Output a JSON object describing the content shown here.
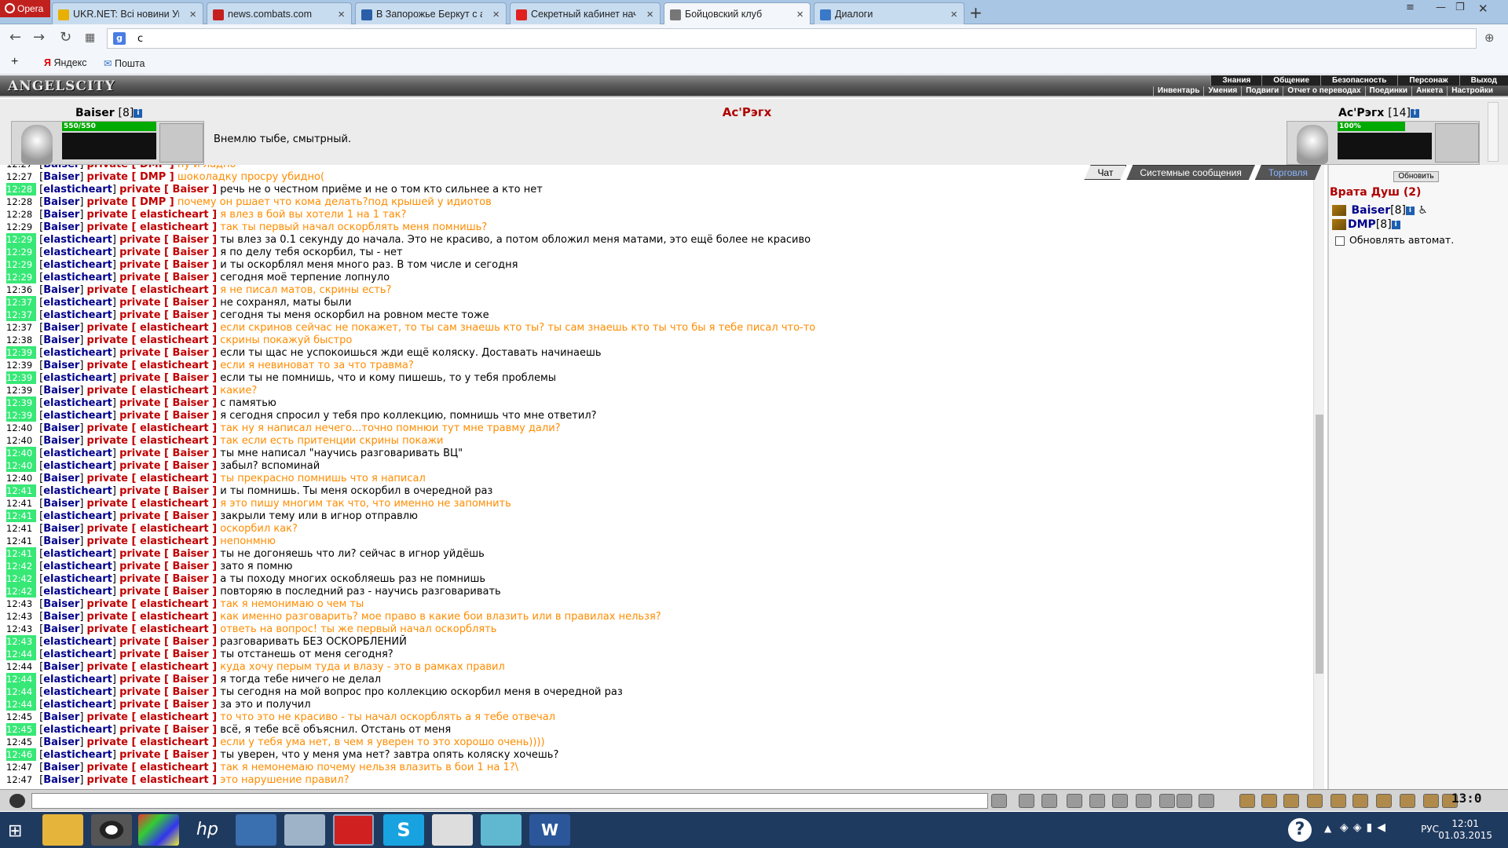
{
  "browser": {
    "menu_label": "Opera",
    "tabs": [
      {
        "label": "UKR.NET: Всі новини Укр",
        "color": "#e8b000"
      },
      {
        "label": "news.combats.com",
        "color": "#c42020"
      },
      {
        "label": "В Запорожье Беркут с ав",
        "color": "#2a5fa8"
      },
      {
        "label": "Секретный кабинет нача",
        "color": "#e02020"
      },
      {
        "label": "Бойцовский клуб",
        "color": "#777777"
      },
      {
        "label": "Диалоги",
        "color": "#3a78c8"
      }
    ],
    "address": "c",
    "bookmarks": [
      "Яндекс",
      "Пошта"
    ]
  },
  "game": {
    "logo": "ANGELSCITY",
    "menu_top": [
      "Знания",
      "Общение",
      "Безопасность",
      "Персонаж",
      "Выход"
    ],
    "menu_sub": [
      "Инвентарь",
      "Умения",
      "Подвиги",
      "Отчет о переводах",
      "Поединки",
      "Анкета",
      "Настройки"
    ]
  },
  "fight": {
    "player": {
      "name": "Baiser",
      "level": "[8]",
      "hp": "550/550"
    },
    "enemy_title": "Ас'Рэгх",
    "enemy": {
      "name": "Ас'Рэгх",
      "level": "[14]",
      "hp": "100%"
    },
    "message": "Внемлю тыбе, смытрный."
  },
  "chat": {
    "tabs": [
      "Чат",
      "Системные сообщения",
      "Торговля"
    ],
    "lines": [
      {
        "time": "12:27",
        "green": false,
        "from": "Baiser",
        "to": "DMP",
        "text": "ну и ладно",
        "out": true
      },
      {
        "time": "12:27",
        "green": false,
        "from": "Baiser",
        "to": "DMP",
        "text": "шоколадку просру убидно(",
        "out": true
      },
      {
        "time": "12:28",
        "green": true,
        "from": "elasticheart",
        "to": "Baiser",
        "text": "речь не о честном приёме и не о том кто сильнее а кто нет",
        "out": false
      },
      {
        "time": "12:28",
        "green": false,
        "from": "Baiser",
        "to": "DMP",
        "text": "почему он ршает что кома делать?под крышей у идиотов",
        "out": true
      },
      {
        "time": "12:28",
        "green": false,
        "from": "Baiser",
        "to": "elasticheart",
        "text": "я влез в бой вы хотели 1 на 1 так?",
        "out": true
      },
      {
        "time": "12:29",
        "green": false,
        "from": "Baiser",
        "to": "elasticheart",
        "text": "так ты первый начал оскорблять меня помнишь?",
        "out": true
      },
      {
        "time": "12:29",
        "green": true,
        "from": "elasticheart",
        "to": "Baiser",
        "text": "ты влез за 0.1 секунду до начала. Это не красиво, а потом обложил меня матами, это ещё более не красиво",
        "out": false
      },
      {
        "time": "12:29",
        "green": true,
        "from": "elasticheart",
        "to": "Baiser",
        "text": "я по делу тебя оскорбил, ты - нет",
        "out": false
      },
      {
        "time": "12:29",
        "green": true,
        "from": "elasticheart",
        "to": "Baiser",
        "text": "и ты оскорблял меня много раз. В том числе и сегодня",
        "out": false
      },
      {
        "time": "12:29",
        "green": true,
        "from": "elasticheart",
        "to": "Baiser",
        "text": "сегодня моё терпение лопнуло",
        "out": false
      },
      {
        "time": "12:36",
        "green": false,
        "from": "Baiser",
        "to": "elasticheart",
        "text": "я не писал матов, скрины есть?",
        "out": true
      },
      {
        "time": "12:37",
        "green": true,
        "from": "elasticheart",
        "to": "Baiser",
        "text": "не сохранял, маты были",
        "out": false
      },
      {
        "time": "12:37",
        "green": true,
        "from": "elasticheart",
        "to": "Baiser",
        "text": "сегодня ты меня оскорбил на ровном месте тоже",
        "out": false
      },
      {
        "time": "12:37",
        "green": false,
        "from": "Baiser",
        "to": "elasticheart",
        "text": "если скринов сейчас не покажет, то ты сам знаешь кто ты? ты сам знаешь кто ты что бы я тебе писал что-то",
        "out": true
      },
      {
        "time": "12:38",
        "green": false,
        "from": "Baiser",
        "to": "elasticheart",
        "text": "скрины покажуй быстро",
        "out": true
      },
      {
        "time": "12:39",
        "green": true,
        "from": "elasticheart",
        "to": "Baiser",
        "text": "если ты щас не успокоишься жди ещё коляску. Доставать начинаешь",
        "out": false
      },
      {
        "time": "12:39",
        "green": false,
        "from": "Baiser",
        "to": "elasticheart",
        "text": "если я невиноват то за что травма?",
        "out": true
      },
      {
        "time": "12:39",
        "green": true,
        "from": "elasticheart",
        "to": "Baiser",
        "text": "если ты не помнишь, что и кому пишешь, то у тебя проблемы",
        "out": false
      },
      {
        "time": "12:39",
        "green": false,
        "from": "Baiser",
        "to": "elasticheart",
        "text": "какие?",
        "out": true
      },
      {
        "time": "12:39",
        "green": true,
        "from": "elasticheart",
        "to": "Baiser",
        "text": "с памятью",
        "out": false
      },
      {
        "time": "12:39",
        "green": true,
        "from": "elasticheart",
        "to": "Baiser",
        "text": "я сегодня спросил у тебя про коллекцию, помнишь что мне ответил?",
        "out": false
      },
      {
        "time": "12:40",
        "green": false,
        "from": "Baiser",
        "to": "elasticheart",
        "text": "так ну я написал нечего...точно помнюи тут мне травму дали?",
        "out": true
      },
      {
        "time": "12:40",
        "green": false,
        "from": "Baiser",
        "to": "elasticheart",
        "text": "так если есть притенции скрины покажи",
        "out": true
      },
      {
        "time": "12:40",
        "green": true,
        "from": "elasticheart",
        "to": "Baiser",
        "text": "ты мне написал \"научись разговаривать ВЦ\"",
        "out": false
      },
      {
        "time": "12:40",
        "green": true,
        "from": "elasticheart",
        "to": "Baiser",
        "text": "забыл? вспоминай",
        "out": false
      },
      {
        "time": "12:40",
        "green": false,
        "from": "Baiser",
        "to": "elasticheart",
        "text": "ты прекрасно помнишь что я написал",
        "out": true
      },
      {
        "time": "12:41",
        "green": true,
        "from": "elasticheart",
        "to": "Baiser",
        "text": "и ты помнишь. Ты меня оскорбил в очередной раз",
        "out": false
      },
      {
        "time": "12:41",
        "green": false,
        "from": "Baiser",
        "to": "elasticheart",
        "text": "я это пишу многим так что, что именно не запомнить",
        "out": true
      },
      {
        "time": "12:41",
        "green": true,
        "from": "elasticheart",
        "to": "Baiser",
        "text": "закрыли тему или в игнор отправлю",
        "out": false
      },
      {
        "time": "12:41",
        "green": false,
        "from": "Baiser",
        "to": "elasticheart",
        "text": "оскорбил как?",
        "out": true
      },
      {
        "time": "12:41",
        "green": false,
        "from": "Baiser",
        "to": "elasticheart",
        "text": "непонмню",
        "out": true
      },
      {
        "time": "12:41",
        "green": true,
        "from": "elasticheart",
        "to": "Baiser",
        "text": "ты не догоняешь что ли? сейчас в игнор уйдёшь",
        "out": false
      },
      {
        "time": "12:42",
        "green": true,
        "from": "elasticheart",
        "to": "Baiser",
        "text": "зато я помню",
        "out": false
      },
      {
        "time": "12:42",
        "green": true,
        "from": "elasticheart",
        "to": "Baiser",
        "text": "а ты походу многих оскобляешь раз не помнишь",
        "out": false
      },
      {
        "time": "12:42",
        "green": true,
        "from": "elasticheart",
        "to": "Baiser",
        "text": "повторяю в последний раз - научись разговаривать",
        "out": false
      },
      {
        "time": "12:43",
        "green": false,
        "from": "Baiser",
        "to": "elasticheart",
        "text": "так я немонимаю о чем ты",
        "out": true
      },
      {
        "time": "12:43",
        "green": false,
        "from": "Baiser",
        "to": "elasticheart",
        "text": "как именно разговарить? мое право в какие бои влазить или в правилах нельзя?",
        "out": true
      },
      {
        "time": "12:43",
        "green": false,
        "from": "Baiser",
        "to": "elasticheart",
        "text": "ответь на вопрос! ты же первый начал оскорблять",
        "out": true
      },
      {
        "time": "12:43",
        "green": true,
        "from": "elasticheart",
        "to": "Baiser",
        "text": "разговаривать БЕЗ ОСКОРБЛЕНИЙ",
        "out": false
      },
      {
        "time": "12:44",
        "green": true,
        "from": "elasticheart",
        "to": "Baiser",
        "text": "ты отстанешь от меня сегодня?",
        "out": false
      },
      {
        "time": "12:44",
        "green": false,
        "from": "Baiser",
        "to": "elasticheart",
        "text": "куда хочу перым туда и влазу - это в рамках правил",
        "out": true
      },
      {
        "time": "12:44",
        "green": true,
        "from": "elasticheart",
        "to": "Baiser",
        "text": "я тогда тебе ничего не делал",
        "out": false
      },
      {
        "time": "12:44",
        "green": true,
        "from": "elasticheart",
        "to": "Baiser",
        "text": "ты сегодня на мой вопрос про коллекцию оскорбил меня в очередной раз",
        "out": false
      },
      {
        "time": "12:44",
        "green": true,
        "from": "elasticheart",
        "to": "Baiser",
        "text": "за это и получил",
        "out": false
      },
      {
        "time": "12:45",
        "green": false,
        "from": "Baiser",
        "to": "elasticheart",
        "text": "то что это не красиво - ты начал оскорблять а я тебе отвечал",
        "out": true
      },
      {
        "time": "12:45",
        "green": true,
        "from": "elasticheart",
        "to": "Baiser",
        "text": "всё, я тебе всё объяснил. Отстань от меня",
        "out": false
      },
      {
        "time": "12:45",
        "green": false,
        "from": "Baiser",
        "to": "elasticheart",
        "text": "если у тебя ума нет, в чем я уверен то это хорошо очень))))",
        "out": true
      },
      {
        "time": "12:46",
        "green": true,
        "from": "elasticheart",
        "to": "Baiser",
        "text": "ты уверен, что у меня ума нет? завтра опять коляску хочешь?",
        "out": false
      },
      {
        "time": "12:47",
        "green": false,
        "from": "Baiser",
        "to": "elasticheart",
        "text": "так я немонемаю почему нельзя влазить в бои 1 на 1?\\",
        "out": true
      },
      {
        "time": "12:47",
        "green": false,
        "from": "Baiser",
        "to": "elasticheart",
        "text": "это нарушение правил?",
        "out": true
      }
    ]
  },
  "side": {
    "refresh_label": "Обновить",
    "room": "Врата Душ (2)",
    "members": [
      {
        "name": "Baiser",
        "level": "[8]"
      },
      {
        "name": "DMP",
        "level": "[8]"
      }
    ],
    "auto_label": "Обновлять автомат."
  },
  "bottom": {
    "clock": "13:0"
  },
  "taskbar": {
    "lang": "РУС",
    "time": "12:01",
    "date": "01.03.2015"
  }
}
